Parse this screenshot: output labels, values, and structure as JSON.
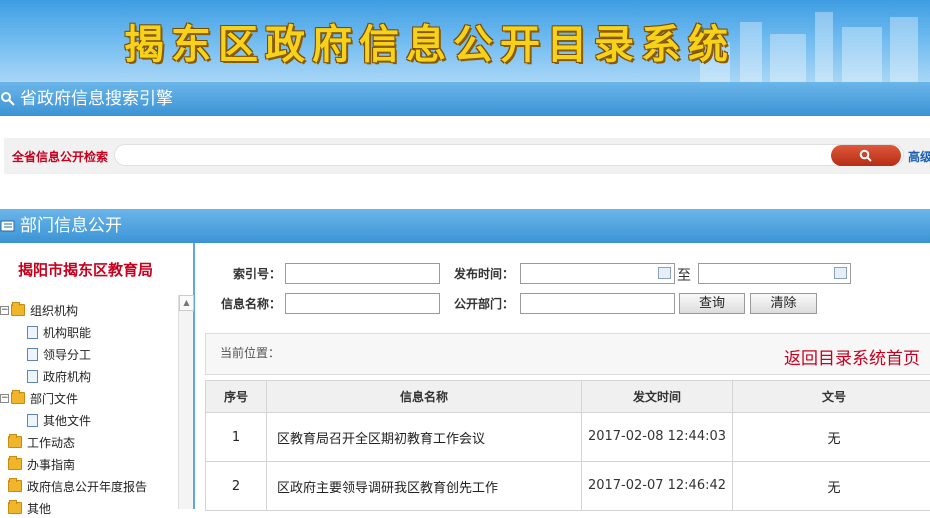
{
  "banner": {
    "title": "揭东区政府信息公开目录系统"
  },
  "search_section": {
    "title": "省政府信息搜索引擎",
    "label": "全省信息公开检索",
    "input_value": "",
    "advanced_label": "高级"
  },
  "dept_section": {
    "title": "部门信息公开"
  },
  "sidebar": {
    "title": "揭阳市揭东区教育局",
    "tree": [
      {
        "label": "组织机构"
      },
      {
        "label": "机构职能"
      },
      {
        "label": "领导分工"
      },
      {
        "label": "政府机构"
      },
      {
        "label": "部门文件"
      },
      {
        "label": "其他文件"
      },
      {
        "label": "工作动态"
      },
      {
        "label": "办事指南"
      },
      {
        "label": "政府信息公开年度报告"
      },
      {
        "label": "其他"
      }
    ]
  },
  "filters": {
    "index_label": "索引号：",
    "date_label": "发布时间：",
    "to_label": "至",
    "name_label": "信息名称：",
    "dept_label": "公开部门：",
    "query_button": "查询",
    "clear_button": "清除"
  },
  "breadcrumb": {
    "label": "当前位置：",
    "back_link": "返回目录系统首页"
  },
  "table": {
    "headers": [
      "序号",
      "信息名称",
      "发文时间",
      "文号"
    ],
    "rows": [
      {
        "no": "1",
        "name": "区教育局召开全区期初教育工作会议",
        "date": "2017-02-08 12:44:03",
        "doc": "无"
      },
      {
        "no": "2",
        "name": "区政府主要领导调研我区教育创先工作",
        "date": "2017-02-07 12:46:42",
        "doc": "无"
      }
    ]
  },
  "colors": {
    "accent_red": "#c8001e",
    "bar_blue": "#3b93d4",
    "link_blue": "#1a5fb4",
    "title_yellow": "#f7d21a"
  }
}
